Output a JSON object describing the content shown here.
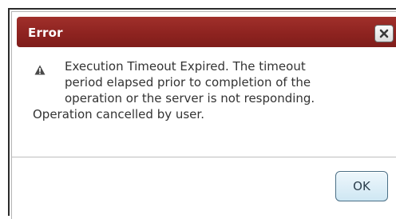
{
  "dialog": {
    "title": "Error",
    "close_icon": "close-icon",
    "warning_icon": "warning-icon",
    "message_lines": [
      "Execution Timeout Expired.  The timeout",
      "period elapsed prior to completion of the",
      "operation or the server is not responding.",
      "Operation cancelled by user."
    ],
    "ok_label": "OK"
  },
  "colors": {
    "titlebar": "#8e2320",
    "title_text": "#ffffff",
    "ok_button_bg": "#cfe7f3",
    "ok_button_border": "#4a6f86"
  }
}
